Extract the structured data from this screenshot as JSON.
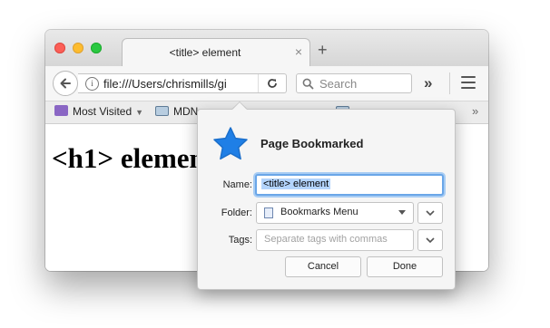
{
  "browser": {
    "tab_title": "<title> element",
    "tab_close": "×",
    "new_tab": "+",
    "url": "file:///Users/chrismills/gi",
    "info_glyph": "i",
    "search_placeholder": "Search",
    "overflow": "»",
    "bookmarks_more": "»"
  },
  "bookmarks_bar": {
    "items": [
      "Most Visited",
      "MDN"
    ]
  },
  "page": {
    "heading": "<h1> element"
  },
  "popup": {
    "title": "Page Bookmarked",
    "name_label": "Name:",
    "name_value": "<title> element",
    "folder_label": "Folder:",
    "folder_value": "Bookmarks Menu",
    "tags_label": "Tags:",
    "tags_placeholder": "Separate tags with commas",
    "cancel": "Cancel",
    "done": "Done"
  },
  "colors": {
    "star": "#1f7fe6",
    "focus_ring": "#6aa6e8"
  }
}
